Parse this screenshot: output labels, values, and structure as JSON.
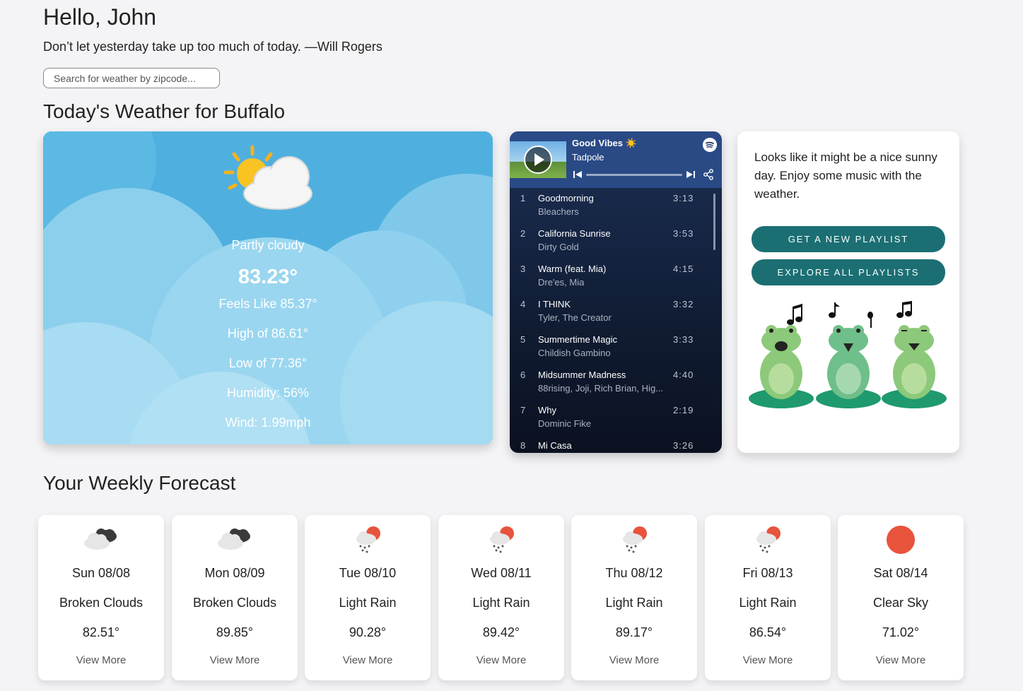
{
  "header": {
    "greeting": "Hello, John",
    "quote": "Don’t let yesterday take up too much of today. —Will Rogers",
    "search_placeholder": "Search for weather by zipcode..."
  },
  "today": {
    "section_title": "Today's Weather for Buffalo",
    "icon": "partly-cloudy-icon",
    "condition": "Partly cloudy",
    "temperature": "83.23°",
    "feels_like": "Feels Like 85.37°",
    "high": "High of 86.61°",
    "low": "Low of 77.36°",
    "humidity": "Humidity: 56%",
    "wind": "Wind: 1.99mph"
  },
  "spotify": {
    "playlist_title": "Good Vibes ☀️",
    "now_playing_artist": "Tadpole",
    "tracks": [
      {
        "num": "1",
        "name": "Goodmorning",
        "artist": "Bleachers",
        "time": "3:13"
      },
      {
        "num": "2",
        "name": "California Sunrise",
        "artist": "Dirty Gold",
        "time": "3:53"
      },
      {
        "num": "3",
        "name": "Warm (feat. Mia)",
        "artist": "Dre'es, Mia",
        "time": "4:15"
      },
      {
        "num": "4",
        "name": "I THINK",
        "artist": "Tyler, The Creator",
        "time": "3:32"
      },
      {
        "num": "5",
        "name": "Summertime Magic",
        "artist": "Childish Gambino",
        "time": "3:33"
      },
      {
        "num": "6",
        "name": "Midsummer Madness",
        "artist": "88rising, Joji, Rich Brian, Hig...",
        "time": "4:40"
      },
      {
        "num": "7",
        "name": "Why",
        "artist": "Dominic Fike",
        "time": "2:19"
      },
      {
        "num": "8",
        "name": "Mi Casa",
        "artist": "",
        "time": "3:26"
      }
    ]
  },
  "music": {
    "message": "Looks like it might be a nice sunny day. Enjoy some music with the weather.",
    "new_playlist_label": "GET A NEW PLAYLIST",
    "explore_label": "EXPLORE ALL PLAYLISTS",
    "accent_color": "#1b6f73"
  },
  "forecast": {
    "section_title": "Your Weekly Forecast",
    "days": [
      {
        "date": "Sun 08/08",
        "desc": "Broken Clouds",
        "temp": "82.51°",
        "more": "View More",
        "icon": "broken-clouds-icon"
      },
      {
        "date": "Mon 08/09",
        "desc": "Broken Clouds",
        "temp": "89.85°",
        "more": "View More",
        "icon": "broken-clouds-icon"
      },
      {
        "date": "Tue 08/10",
        "desc": "Light Rain",
        "temp": "90.28°",
        "more": "View More",
        "icon": "light-rain-icon"
      },
      {
        "date": "Wed 08/11",
        "desc": "Light Rain",
        "temp": "89.42°",
        "more": "View More",
        "icon": "light-rain-icon"
      },
      {
        "date": "Thu 08/12",
        "desc": "Light Rain",
        "temp": "89.17°",
        "more": "View More",
        "icon": "light-rain-icon"
      },
      {
        "date": "Fri 08/13",
        "desc": "Light Rain",
        "temp": "86.54°",
        "more": "View More",
        "icon": "light-rain-icon"
      },
      {
        "date": "Sat 08/14",
        "desc": "Clear Sky",
        "temp": "71.02°",
        "more": "View More",
        "icon": "clear-sky-icon"
      }
    ]
  }
}
